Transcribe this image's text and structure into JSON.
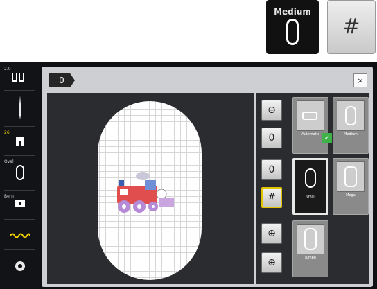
{
  "top_buttons": {
    "hoop_label": "Medium",
    "grid_icon": "grid-icon"
  },
  "sidebar": {
    "items": [
      {
        "small": "2.0",
        "icon": "stitch-width-icon"
      },
      {
        "small": "",
        "icon": "needle-icon"
      },
      {
        "small": "26",
        "icon": "presser-foot-icon"
      },
      {
        "small": "Oval",
        "icon": "hoop-icon"
      },
      {
        "small": "Bern",
        "icon": "stitch-plate-icon"
      },
      {
        "small": "",
        "icon": "thread-icon"
      },
      {
        "small": "",
        "icon": "bobbin-icon"
      }
    ]
  },
  "panel": {
    "title_glyph": "0",
    "close_glyph": "×"
  },
  "tools": [
    {
      "glyph": "⊖",
      "icon": "hoop-center-icon"
    },
    {
      "glyph": "0",
      "icon": "hoop-check-icon"
    },
    {
      "glyph": "0",
      "icon": "hoop-attach-icon"
    },
    {
      "glyph": "#",
      "icon": "grid-icon"
    },
    {
      "glyph": "⊕",
      "icon": "center-icon"
    },
    {
      "glyph": "⊕",
      "icon": "crosshair-icon"
    }
  ],
  "hoops": [
    {
      "name": "Automatic",
      "size": "",
      "state": "gray",
      "icon": "auto-hoop-icon"
    },
    {
      "name": "Medium",
      "size": "",
      "state": "gray",
      "icon": "medium-hoop-icon"
    },
    {
      "name": "Oval",
      "size": "",
      "state": "active",
      "icon": "oval-hoop-icon"
    },
    {
      "name": "Mega",
      "size": "",
      "state": "gray",
      "icon": "mega-hoop-icon"
    },
    {
      "name": "Jumbo",
      "size": "",
      "state": "gray",
      "icon": "jumbo-hoop-icon"
    }
  ],
  "colors": {
    "accent_yellow": "#e2c400",
    "check_green": "#3fb34a"
  }
}
